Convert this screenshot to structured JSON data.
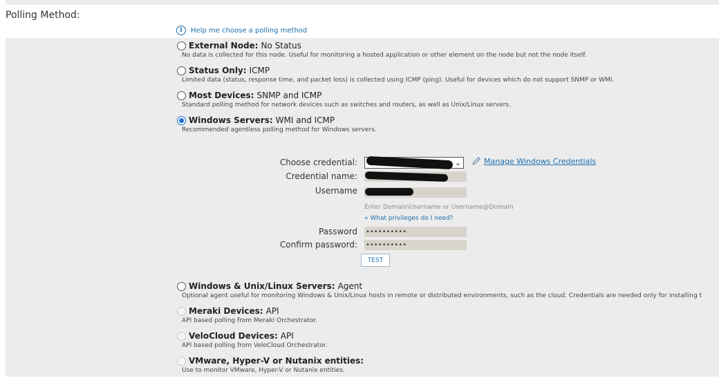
{
  "section": {
    "title": "Polling Method:"
  },
  "help": {
    "icon": "info-icon",
    "link": "Help me choose a polling method"
  },
  "options": [
    {
      "title": "External Node:",
      "suffix": "No Status",
      "desc": "No data is collected for this node. Useful for monitoring a hosted application or other element on the node but not the node itself.",
      "state": "unchecked"
    },
    {
      "title": "Status Only:",
      "suffix": "ICMP",
      "desc": "Limited data (status, response time, and packet loss) is collected using ICMP (ping). Useful for devices which do not support SNMP or WMI.",
      "state": "unchecked"
    },
    {
      "title": "Most Devices:",
      "suffix": "SNMP and ICMP",
      "desc": "Standard polling method for network devices such as switches and routers, as well as Unix/Linux servers.",
      "state": "unchecked"
    },
    {
      "title": "Windows Servers:",
      "suffix": "WMI and ICMP",
      "desc": "Recommended agentless polling method for Windows servers.",
      "state": "checked"
    },
    {
      "title": "Windows & Unix/Linux Servers:",
      "suffix": "Agent",
      "desc": "Optional agent useful for monitoring Windows & Unix/Linux hosts in remote or distributed environments, such as the cloud. Credentials are needed only for installing t",
      "state": "unchecked"
    },
    {
      "title": "Meraki Devices:",
      "suffix": "API",
      "desc": "API based polling from Meraki Orchestrator.",
      "state": "disabled"
    },
    {
      "title": "VeloCloud Devices:",
      "suffix": "API",
      "desc": "API based polling from VeloCloud Orchestrator.",
      "state": "disabled"
    },
    {
      "title": "VMware, Hyper-V or Nutanix entities:",
      "suffix": "",
      "desc": "Use to monitor VMware, Hyper-V or Nutanix entities.",
      "state": "disabled"
    }
  ],
  "form": {
    "choose_credential_label": "Choose credential:",
    "credential_name_label": "Credential name:",
    "username_label": "Username",
    "password_label": "Password",
    "confirm_password_label": "Confirm password:",
    "password_value": "••••••••••",
    "confirm_password_value": "••••••••••",
    "username_hint": "Enter Domain\\Username or Username@Domain",
    "privileges_prefix": "» ",
    "privileges_link": "What privileges do I need?",
    "manage_link": "Manage Windows Credentials",
    "manage_icon": "pencil-icon",
    "select_icon": "chevron-down-icon",
    "test_button": "TEST"
  },
  "colors": {
    "panel": "#ececec",
    "link": "#1a6fae",
    "field": "#d8d4cc",
    "radio_checked": "#1d6fd1"
  }
}
